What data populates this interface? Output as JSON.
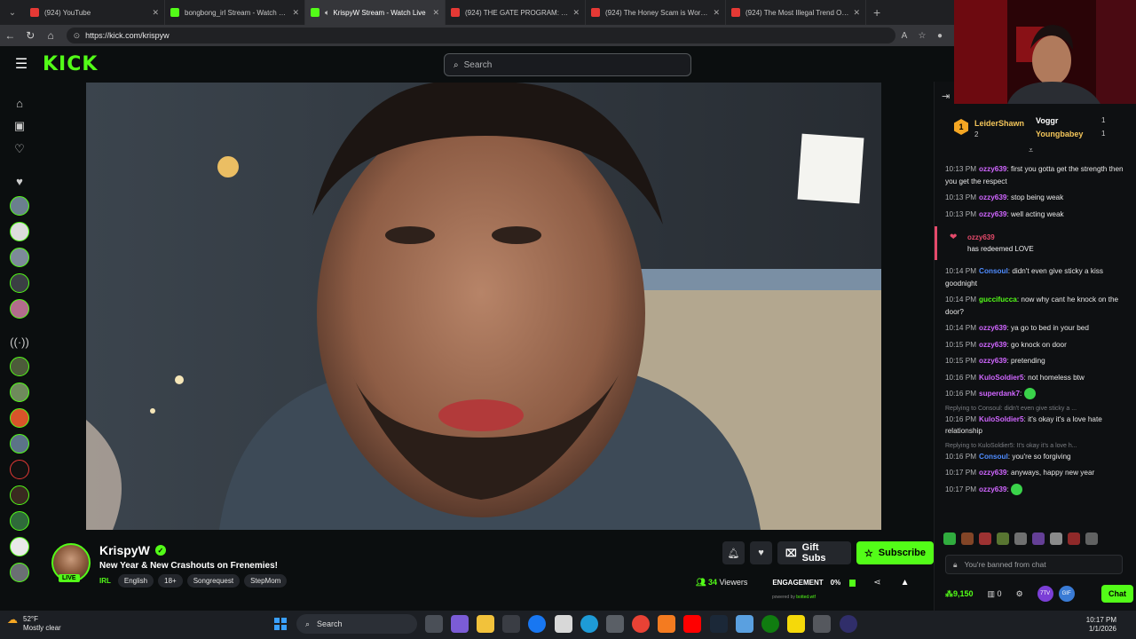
{
  "browser": {
    "tabs": [
      {
        "title": "(924) YouTube",
        "favicon": "youtube-icon",
        "active": false
      },
      {
        "title": "bongbong_irl Stream - Watch Live",
        "favicon": "kick-icon",
        "active": false
      },
      {
        "title": "KrispyW Stream - Watch Live",
        "favicon": "kick-icon",
        "active": true
      },
      {
        "title": "(924) THE GATE PROGRAM: Were",
        "favicon": "youtube-icon",
        "active": false
      },
      {
        "title": "(924) The Honey Scam is Worse T",
        "favicon": "youtube-icon",
        "active": false
      },
      {
        "title": "(924) The Most Illegal Trend Of 20",
        "favicon": "youtube-icon",
        "active": false
      }
    ],
    "url": "https://kick.com/krispyw"
  },
  "kick": {
    "logo": "KICK",
    "search_placeholder": "Search"
  },
  "stream": {
    "channel_name": "KrispyW",
    "title": "New Year & New Crashouts on Frenemies!",
    "live_label": "LIVE",
    "category": "IRL",
    "tags": [
      "English",
      "18+",
      "Songrequest",
      "StepMom"
    ],
    "gift_label": "Gift Subs",
    "subscribe_label": "Subscribe",
    "viewers_count": "34",
    "viewers_label": "Viewers",
    "engagement_label": "ENGAGEMENT",
    "engagement_value": "0%",
    "powered_prefix": "powered by",
    "powered_brand": "botted.wtf"
  },
  "leaderboard": {
    "first": {
      "rank": "1",
      "name": "LeiderShawn",
      "count": "2"
    },
    "second": {
      "name": "Voggr",
      "count": "1"
    },
    "third": {
      "name": "Youngbabey",
      "count": "1"
    }
  },
  "chat": {
    "messages": [
      {
        "time": "10:13 PM",
        "user": "ozzy639",
        "color": "#d066ff",
        "text": "first you gotta get the strength then you get the respect"
      },
      {
        "time": "10:13 PM",
        "user": "ozzy639",
        "color": "#d066ff",
        "text": "stop being weak"
      },
      {
        "time": "10:13 PM",
        "user": "ozzy639",
        "color": "#d066ff",
        "text": "well acting weak"
      }
    ],
    "redeem": {
      "user": "ozzy639",
      "text": "has redeemed LOVE"
    },
    "messages2": [
      {
        "time": "10:14 PM",
        "user": "Consoul",
        "color": "#4f8cff",
        "text": "didn't even give sticky a kiss goodnight"
      },
      {
        "time": "10:14 PM",
        "user": "guccifucca",
        "color": "#53fc18",
        "text": "now why cant he knock on the door?"
      },
      {
        "time": "10:14 PM",
        "user": "ozzy639",
        "color": "#d066ff",
        "text": "ya go to bed in your bed"
      },
      {
        "time": "10:15 PM",
        "user": "ozzy639",
        "color": "#d066ff",
        "text": "go knock on door"
      },
      {
        "time": "10:15 PM",
        "user": "ozzy639",
        "color": "#d066ff",
        "text": "pretending"
      },
      {
        "time": "10:16 PM",
        "user": "KuloSoldier5",
        "color": "#d066ff",
        "text": "not homeless btw"
      },
      {
        "time": "10:16 PM",
        "user": "superdank7",
        "color": "#d066ff",
        "text": ""
      }
    ],
    "reply1": {
      "ref": "Replying to Consoul: didn't even give sticky a ...",
      "time": "10:16 PM",
      "user": "KuloSoldier5",
      "color": "#d066ff",
      "text": "it's okay it's a love hate relationship"
    },
    "reply2": {
      "ref": "Replying to KuloSoldier5: It's okay it's a love h...",
      "time": "10:16 PM",
      "user": "Consoul",
      "color": "#4f8cff",
      "text": "you're so forgiving"
    },
    "messages3": [
      {
        "time": "10:17 PM",
        "user": "ozzy639",
        "color": "#d066ff",
        "text": "anyways, happy new year"
      },
      {
        "time": "10:17 PM",
        "user": "ozzy639",
        "color": "#d066ff",
        "text": ""
      }
    ],
    "banned_text": "You're banned from chat",
    "points": "9,150",
    "kicks": "0",
    "chat_button": "Chat"
  },
  "taskbar": {
    "temperature": "52°F",
    "condition": "Mostly clear",
    "search_label": "Search",
    "time": "10:17 PM",
    "date": "1/1/2026"
  }
}
